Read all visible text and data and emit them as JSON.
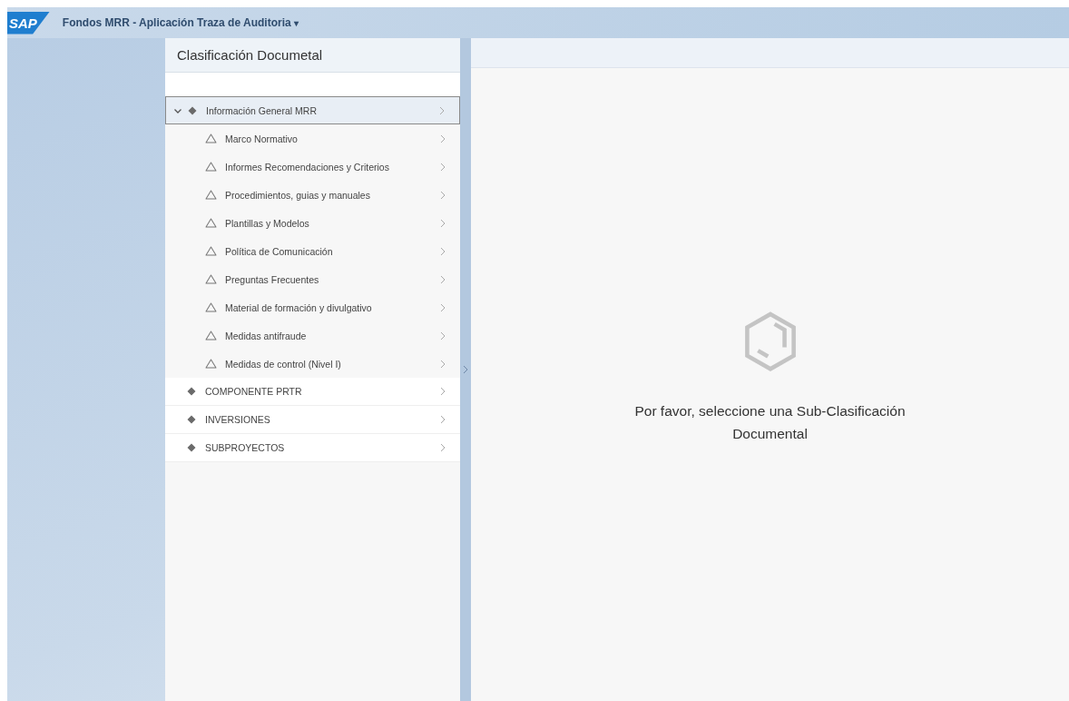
{
  "shell": {
    "logo": "SAP",
    "title": "Fondos MRR - Aplicación Traza de Auditoria",
    "title_menu": "▾"
  },
  "master": {
    "title": "Clasificación Documetal",
    "tree": [
      {
        "label": "Información General MRR",
        "selected": true,
        "expanded": true,
        "children": [
          {
            "label": "Marco Normativo",
            "selected": false
          },
          {
            "label": "Informes Recomendaciones y Criterios",
            "selected": false
          },
          {
            "label": "Procedimientos, guias y manuales",
            "selected": false
          },
          {
            "label": "Plantillas y Modelos",
            "selected": false
          },
          {
            "label": "Política de Comunicación",
            "selected": false
          },
          {
            "label": "Preguntas Frecuentes",
            "selected": false
          },
          {
            "label": "Material de formación y divulgativo",
            "selected": false
          },
          {
            "label": "Medidas antifraude",
            "selected": false
          },
          {
            "label": "Medidas de control (Nivel I)",
            "selected": false
          }
        ]
      },
      {
        "label": "COMPONENTE PRTR",
        "selected": false,
        "expanded": false
      },
      {
        "label": "INVERSIONES",
        "selected": false,
        "expanded": false
      },
      {
        "label": "SUBPROYECTOS",
        "selected": false,
        "expanded": false
      }
    ]
  },
  "detail": {
    "message": "Por favor, seleccione una Sub-Clasificación Documental"
  }
}
